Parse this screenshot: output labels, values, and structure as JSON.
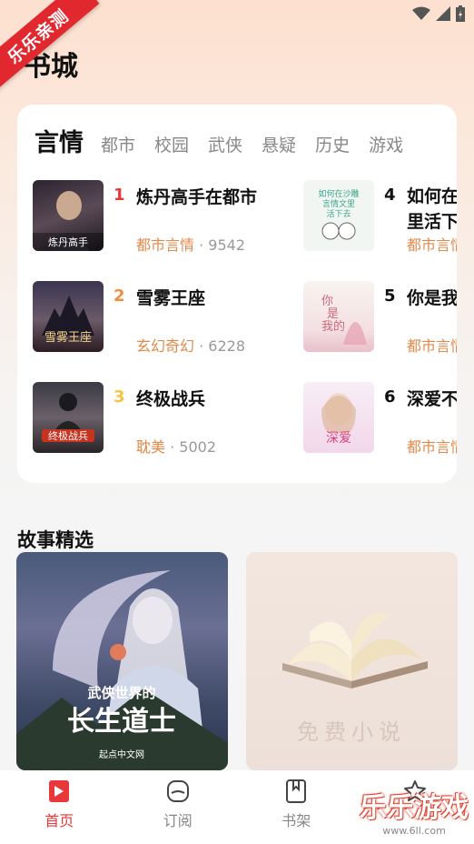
{
  "ribbon": "乐乐亲测",
  "page_title": "书城",
  "tabs": [
    {
      "label": "言情",
      "active": true
    },
    {
      "label": "都市"
    },
    {
      "label": "校园"
    },
    {
      "label": "武侠"
    },
    {
      "label": "悬疑"
    },
    {
      "label": "历史"
    },
    {
      "label": "游戏"
    }
  ],
  "books": [
    {
      "rank": "1",
      "title": "炼丹高手在都市",
      "category": "都市言情",
      "count": "9542",
      "rank_color": "#e5393b",
      "cover_text": "炼丹高手在都市"
    },
    {
      "rank": "2",
      "title": "雪雾王座",
      "category": "玄幻奇幻",
      "count": "6228",
      "rank_color": "#f08c3e",
      "cover_text": "雪雾王座"
    },
    {
      "rank": "3",
      "title": "终极战兵",
      "category": "耽美",
      "count": "5002",
      "rank_color": "#f5c342",
      "cover_text": "终极战兵"
    },
    {
      "rank": "4",
      "title": "如何在沙雕言情文里活下去",
      "category": "都市言情",
      "count": "",
      "rank_color": "#111111",
      "cover_text": "如何在沙雕言情文里活下去"
    },
    {
      "rank": "5",
      "title": "你是我的",
      "category": "都市言情",
      "count": "",
      "rank_color": "#111111",
      "cover_text": "你是我的"
    },
    {
      "rank": "6",
      "title": "深爱不言情",
      "category": "都市言情",
      "count": "",
      "rank_color": "#111111",
      "cover_text": "深爱不言情"
    }
  ],
  "section_title": "故事精选",
  "stories": [
    {
      "title": "武侠世界的长生道士",
      "subtitle": "武侠世界的",
      "big": "长生道士",
      "brand": "起点中文网"
    },
    {
      "title": "免费小说"
    }
  ],
  "nav": [
    {
      "label": "首页",
      "icon": "home-icon",
      "active": true
    },
    {
      "label": "订阅",
      "icon": "subscribe-icon"
    },
    {
      "label": "书架",
      "icon": "bookshelf-icon"
    },
    {
      "label": "",
      "icon": "profile-icon"
    }
  ],
  "watermark": {
    "text": "乐乐游戏",
    "url": "www.6ll.com"
  }
}
